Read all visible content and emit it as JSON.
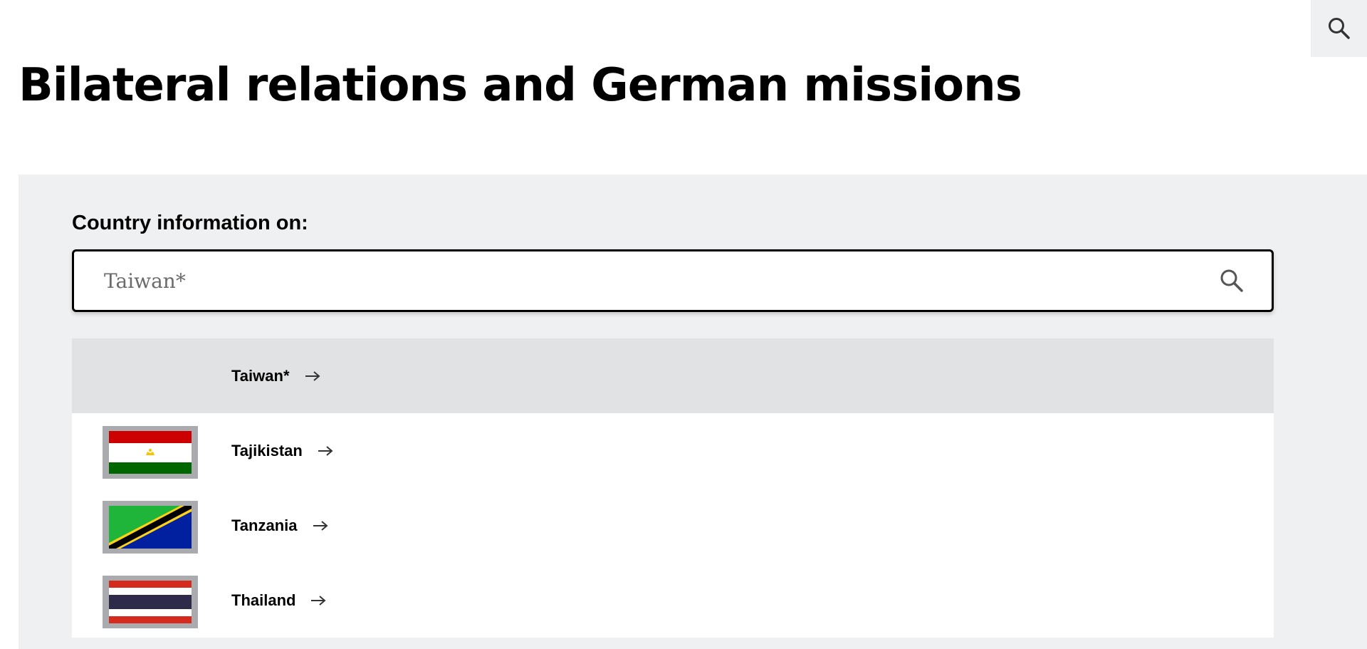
{
  "header": {
    "search_icon": "search-icon"
  },
  "page": {
    "title": "Bilateral relations and German missions"
  },
  "country_search": {
    "label": "Country information on:",
    "input_value": "Taiwan*",
    "search_icon": "search-icon"
  },
  "results": [
    {
      "name": "Taiwan*",
      "flag": "none",
      "highlighted": true,
      "arrow_icon": "arrow-right-icon"
    },
    {
      "name": "Tajikistan",
      "flag": "tajikistan-flag",
      "highlighted": false,
      "arrow_icon": "arrow-right-icon"
    },
    {
      "name": "Tanzania",
      "flag": "tanzania-flag",
      "highlighted": false,
      "arrow_icon": "arrow-right-icon"
    },
    {
      "name": "Thailand",
      "flag": "thailand-flag",
      "highlighted": false,
      "arrow_icon": "arrow-right-icon"
    }
  ],
  "colors": {
    "panel_background": "#eff0f2",
    "highlight_row": "#e1e2e4",
    "flag_frame": "#a9abae"
  }
}
